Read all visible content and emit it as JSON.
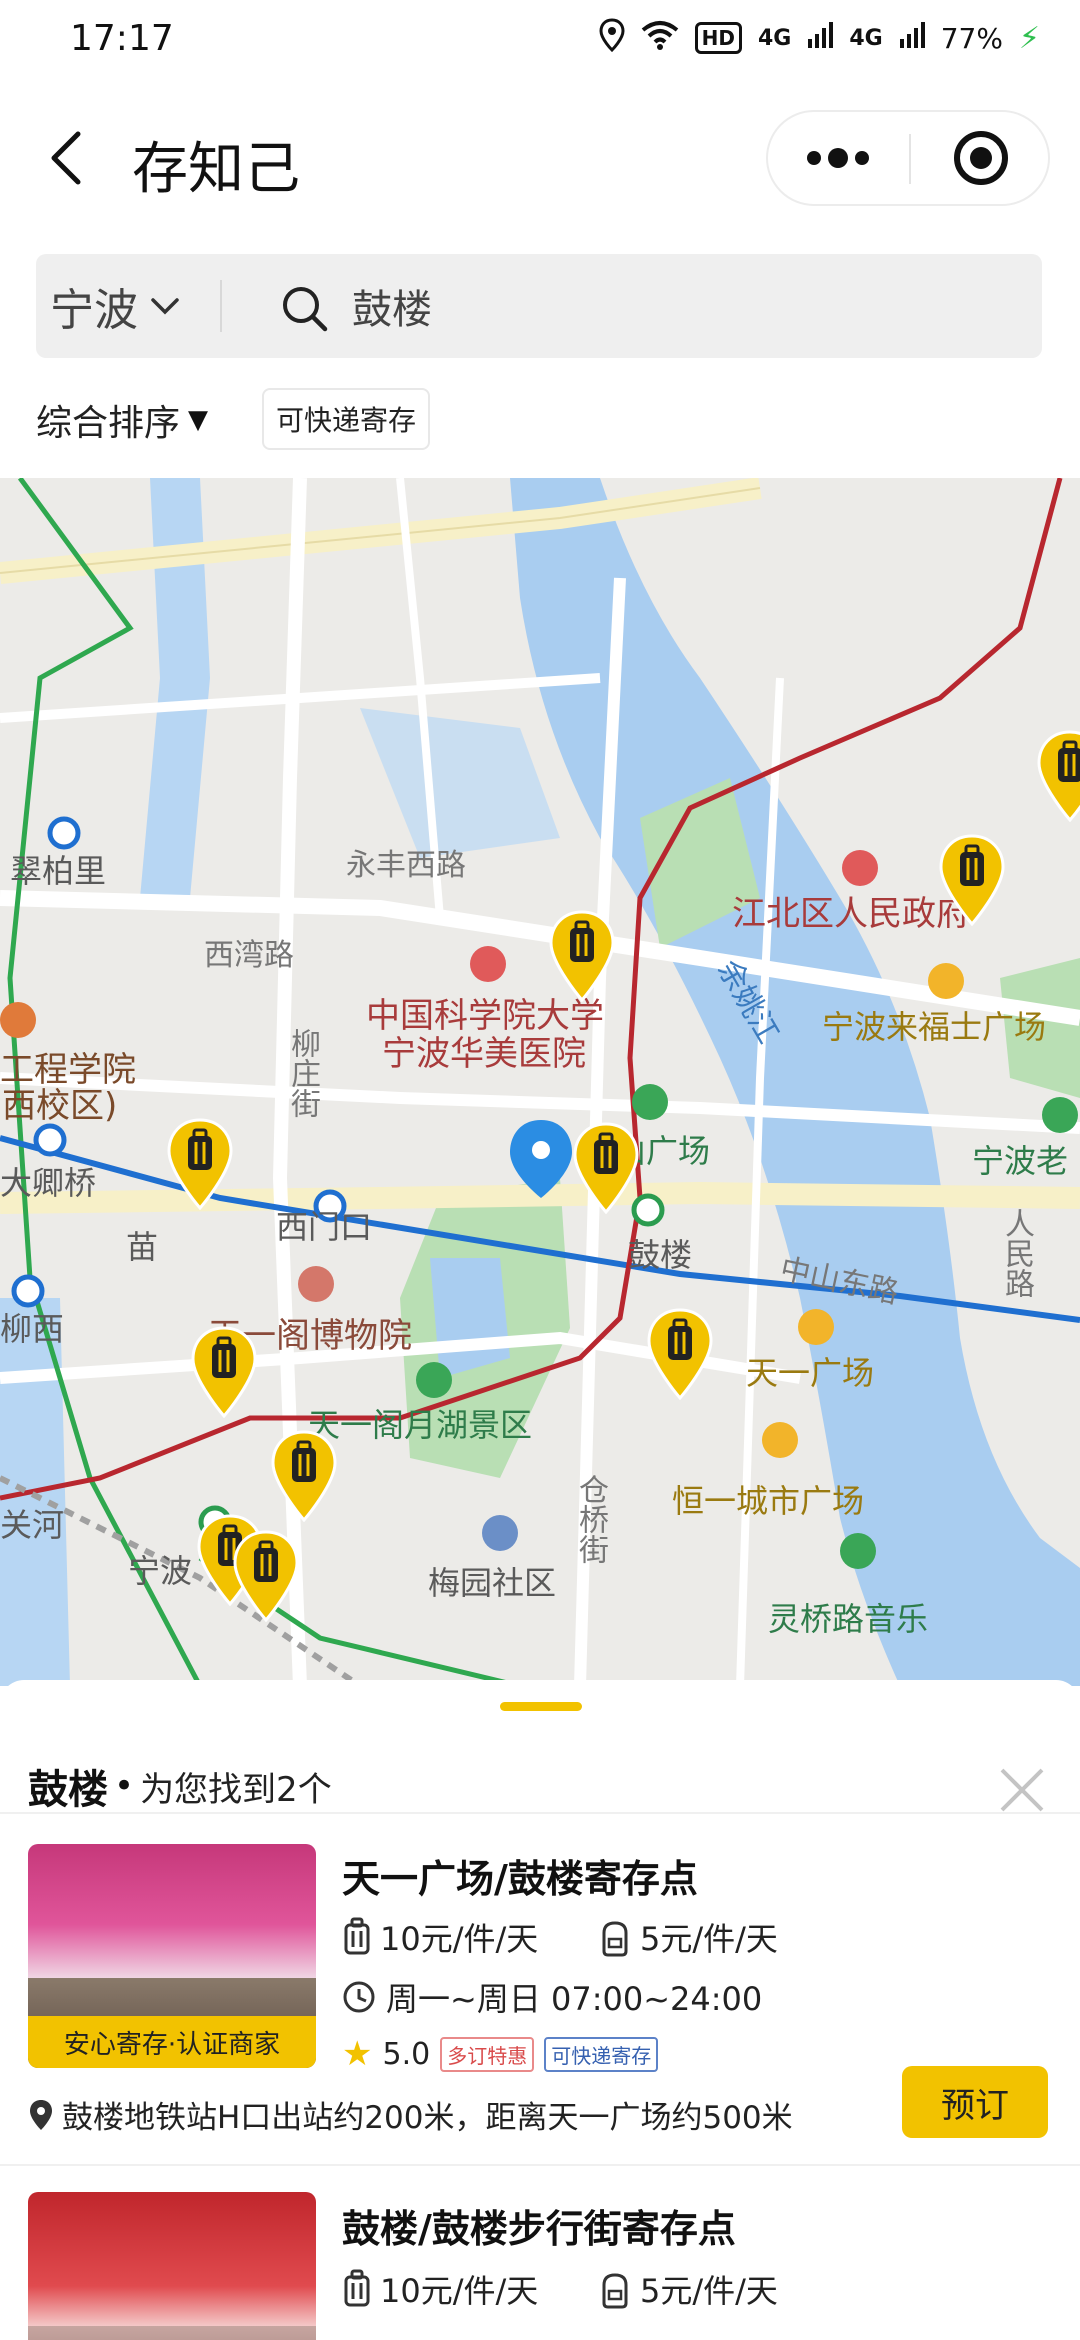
{
  "status_bar": {
    "time": "17:17",
    "battery": "77%",
    "network_a": "4G",
    "network_b": "4G",
    "hd": "HD"
  },
  "header": {
    "title": "存知己"
  },
  "search": {
    "city": "宁波",
    "query": "鼓楼"
  },
  "filters": {
    "sort_label": "综合排序",
    "sort_arrow": "▼",
    "express_chip": "可快递寄存"
  },
  "map": {
    "labels": {
      "cuibaili": "翠柏里",
      "yongfeng_road": "永丰西路",
      "jiangbei_gov": "江北区人民政府",
      "xiwan_road": "西湾路",
      "hospital_1": "中国科学院大学",
      "hospital_2": "宁波华美医院",
      "yuyao_river": "余姚江",
      "laifushi": "宁波来福士广场",
      "gongcheng_1": "工程学院",
      "gongcheng_2": "西校区)",
      "liuzhuang_street": "柳庄街",
      "zhongshan_plaza": "中山广场",
      "ningbo_lao": "宁波老",
      "daqing_bridge": "大卿桥",
      "ximenkou": "西门口",
      "gulou": "鼓楼",
      "zhongshan_east": "中山东路",
      "renmin_road": "人民路",
      "miao": "苗",
      "tianyige_museum": "天一阁博物院",
      "liuxi": "柳西",
      "tianyi_plaza": "天一广场",
      "yuehu": "天一阁月湖景区",
      "hengyi_plaza": "恒一城市广场",
      "guanhe": "关河",
      "cangqiao_street": "仓桥街",
      "ningbo_station": "宁波",
      "meiyuan": "梅园社区",
      "lingqiao_road": "灵桥路音乐"
    }
  },
  "sheet": {
    "keyword": "鼓楼",
    "dot": "•",
    "count_text": "为您找到2个",
    "stores": [
      {
        "name": "天一广场/鼓楼寄存点",
        "badge": "安心寄存·认证商家",
        "price_large": "10元/件/天",
        "price_small": "5元/件/天",
        "hours": "周一~周日 07:00~24:00",
        "rating": "5.0",
        "tag_discount": "多订特惠",
        "tag_express": "可快递寄存",
        "location": "鼓楼地铁站H口出站约200米，距离天一广场约500米",
        "book_label": "预订"
      },
      {
        "name": "鼓楼/鼓楼步行街寄存点",
        "price_large": "10元/件/天",
        "price_small": "5元/件/天"
      }
    ]
  },
  "colors": {
    "accent": "#f2c200",
    "map_water": "#a9cdf0",
    "map_green": "#b9dfb4",
    "metro_blue": "#1f6fd0",
    "rail_red": "#b8272f"
  }
}
